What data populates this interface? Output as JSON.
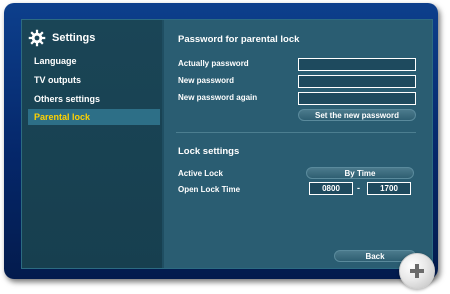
{
  "sidebar": {
    "title": "Settings",
    "items": [
      {
        "label": "Language"
      },
      {
        "label": "TV outputs"
      },
      {
        "label": "Others settings"
      },
      {
        "label": "Parental lock"
      }
    ]
  },
  "main": {
    "password_section_title": "Password for parental lock",
    "fields": [
      {
        "label": "Actually password",
        "value": ""
      },
      {
        "label": "New password",
        "value": ""
      },
      {
        "label": "New password again",
        "value": ""
      }
    ],
    "set_button_label": "Set the new password",
    "lock_section_title": "Lock settings",
    "active_lock_label": "Active Lock",
    "active_lock_value": "By Time",
    "open_lock_time_label": "Open Lock Time",
    "open_time_from": "0800",
    "open_time_separator": "-",
    "open_time_to": "1700",
    "back_label": "Back"
  },
  "colors": {
    "accent_selected_text": "#ffd200",
    "panel": "#2a5d72",
    "frame": "#05276a"
  },
  "icons": [
    "gear-icon",
    "zoom-plus-icon"
  ]
}
